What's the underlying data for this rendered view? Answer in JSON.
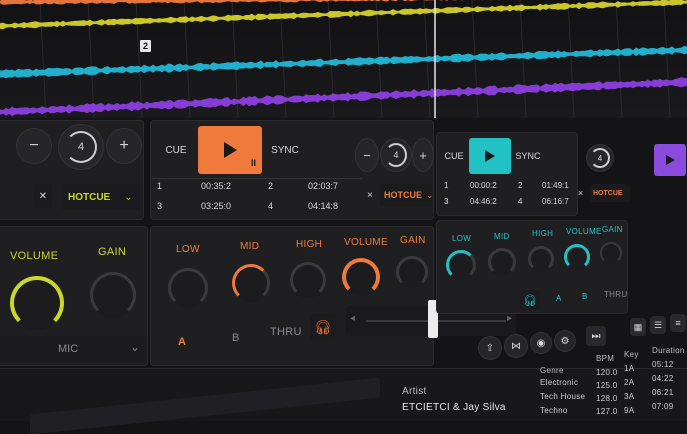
{
  "waveform": {
    "marker_label": "2",
    "colors": {
      "yellow": "#d6d12a",
      "orange": "#f07a3c",
      "cyan": "#22b7d6",
      "purple": "#8b3fe0"
    }
  },
  "deck_left": {
    "minus": "−",
    "plus": "+",
    "loop_value": "4",
    "hotcue_label": "HOTCUE",
    "volume_label": "VOLUME",
    "gain_label": "GAIN",
    "mic_label": "MIC"
  },
  "deck_main": {
    "cue_label": "CUE",
    "sync_label": "SYNC",
    "hotcues": [
      {
        "n": "1",
        "time": "00:35:2"
      },
      {
        "n": "2",
        "time": "02:03:7"
      },
      {
        "n": "3",
        "time": "03:25:0"
      },
      {
        "n": "4",
        "time": "04:14:8"
      }
    ],
    "minus": "−",
    "plus": "+",
    "loop_value": "4",
    "hotcue_label": "HOTCUE",
    "close": "×",
    "eq": {
      "low": "LOW",
      "mid": "MID",
      "high": "HIGH",
      "volume": "VOLUME",
      "gain": "GAIN"
    },
    "a_label": "A",
    "b_label": "B",
    "thru_label": "THRU"
  },
  "deck_right": {
    "cue_label": "CUE",
    "sync_label": "SYNC",
    "hotcues": [
      {
        "n": "1",
        "time": "00:00:2"
      },
      {
        "n": "2",
        "time": "01:49:1"
      },
      {
        "n": "3",
        "time": "04:46:2"
      },
      {
        "n": "4",
        "time": "06:16:7"
      }
    ],
    "close": "×",
    "hotcue_label": "HOTCUE",
    "eq": {
      "low": "LOW",
      "mid": "MID",
      "high": "HIGH",
      "volume": "VOLUME",
      "gain": "GAIN"
    },
    "a_label": "A",
    "b_label": "B",
    "thru_label": "THRU",
    "loop_value": "4"
  },
  "library": {
    "artist_header": "Artist",
    "artist_value": "ETCIETCI & Jay Silva",
    "genre_header": "Genre",
    "genres": [
      "Electronic",
      "Tech House",
      "Techno"
    ],
    "bpm_header": "BPM",
    "bpms": [
      "120.0",
      "125.0",
      "128.0",
      "127.0"
    ],
    "key_header": "Key",
    "keys": [
      "1A",
      "2A",
      "3A",
      "9A"
    ],
    "duration_header": "Duration",
    "durations": [
      "05:12",
      "04:22",
      "06:21",
      "07:09"
    ]
  }
}
